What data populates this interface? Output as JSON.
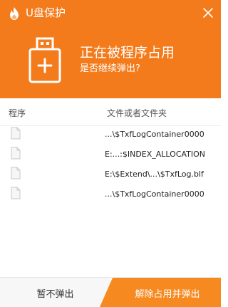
{
  "window": {
    "title": "U盘保护",
    "logo_icon": "flame-shield-icon",
    "close_icon": "close-icon"
  },
  "banner": {
    "icon": "usb-drive-plus-icon",
    "headline": "正在被程序占用",
    "subline": "是否继续弹出?"
  },
  "table": {
    "columns": {
      "program": "程序",
      "file": "文件或者文件夹"
    },
    "rows": [
      {
        "icon": "file-icon",
        "path": "...\\$TxfLogContainer0000"
      },
      {
        "icon": "file-icon",
        "path": "E:...:$INDEX_ALLOCATION"
      },
      {
        "icon": "file-icon",
        "path": "E:\\$Extend\\...\\$TxfLog.blf"
      },
      {
        "icon": "file-icon",
        "path": "...\\$TxfLogContainer0000"
      }
    ]
  },
  "footer": {
    "cancel_label": "暂不弹出",
    "confirm_label": "解除占用并弹出"
  },
  "colors": {
    "accent": "#f47b1c",
    "confirm_button": "#f6891f"
  }
}
